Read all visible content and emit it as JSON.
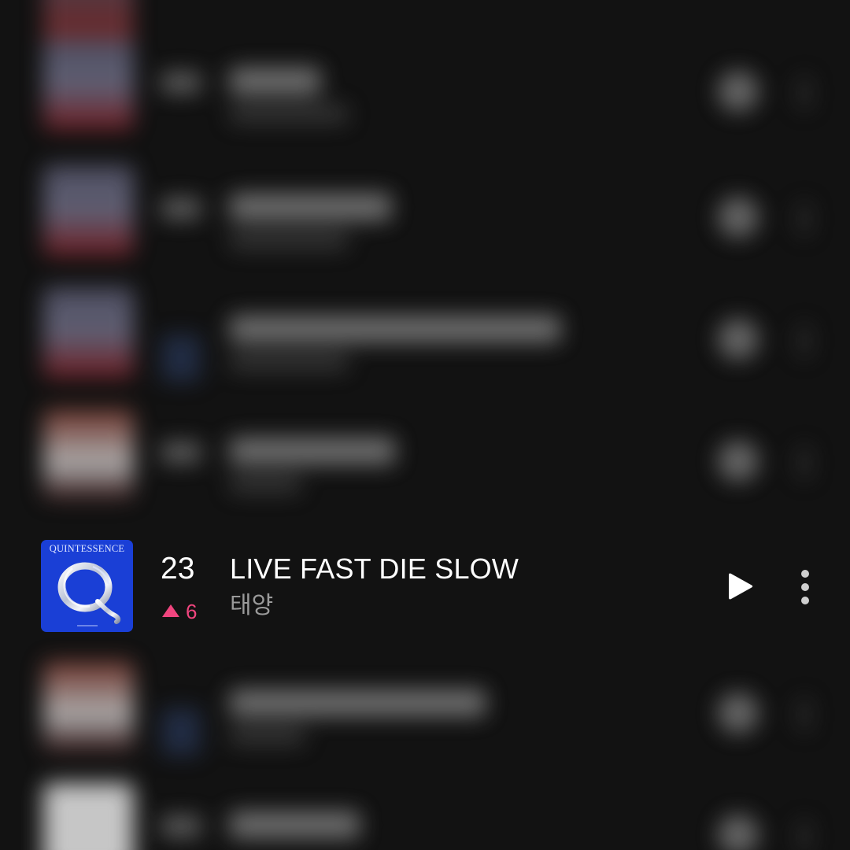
{
  "chart_item": {
    "rank": "23",
    "rank_change": "6",
    "rank_change_direction": "up",
    "title": "LIVE FAST DIE SLOW",
    "artist": "태양",
    "album_cover_text": "QUINTESSENCE"
  },
  "icons": {
    "play": "play-icon",
    "more": "more-vertical-icon",
    "rank_change": "triangle-up-icon"
  },
  "colors": {
    "background": "#121212",
    "rank_up": "#f0457e",
    "cover_blue": "#1a3fd6",
    "title_text": "#ffffff",
    "artist_text": "#9a9a9a"
  }
}
